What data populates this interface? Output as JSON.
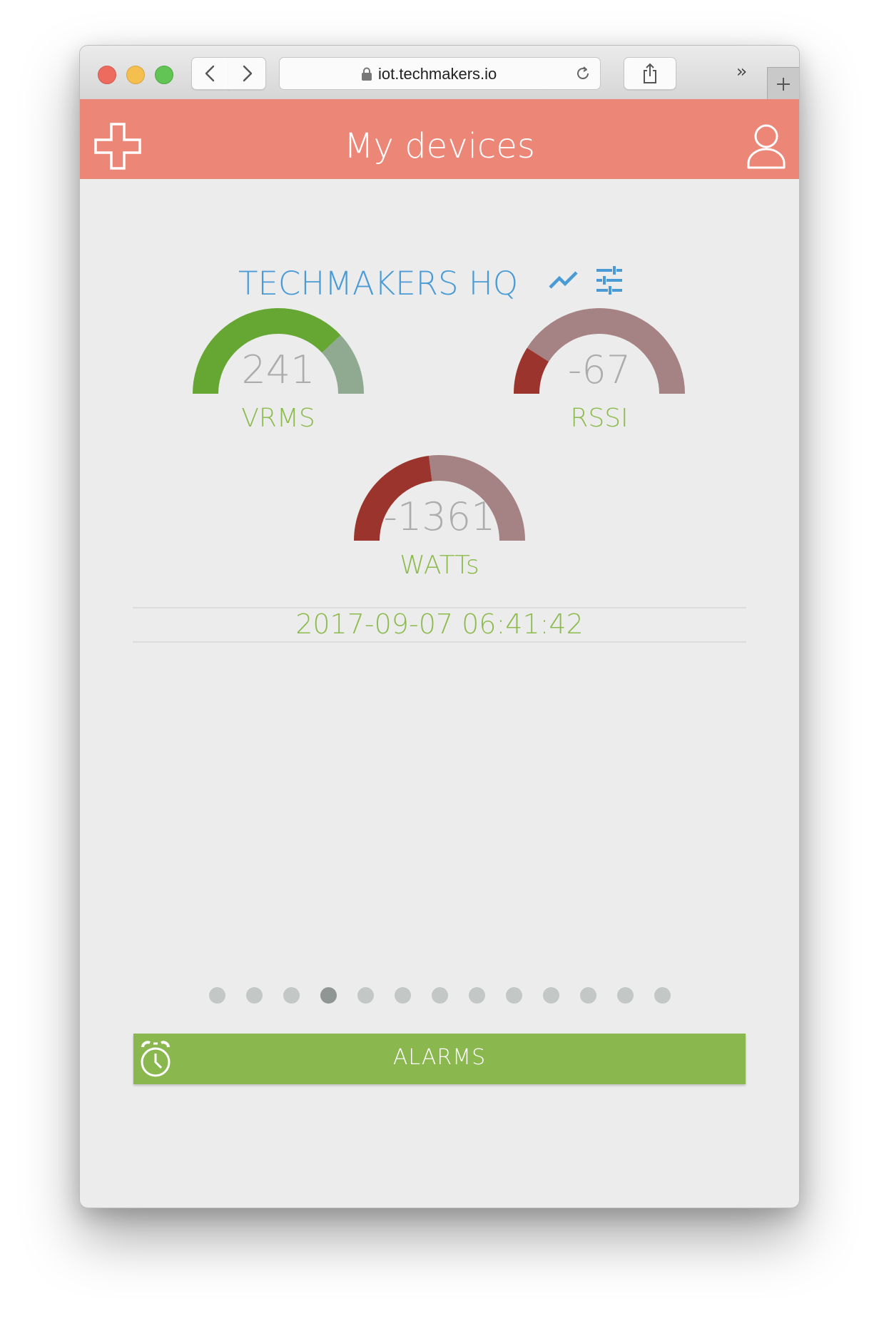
{
  "browser": {
    "url": "iot.techmakers.io",
    "icons": [
      "back-arrow-icon",
      "forward-arrow-icon",
      "lock-icon",
      "reload-icon",
      "share-icon",
      "chevrons-icon",
      "new-tab-icon"
    ]
  },
  "app": {
    "title": "My devices",
    "colors": {
      "header": "#ec8677",
      "accent_blue": "#4a9bd5",
      "accent_green": "#8ab84f"
    }
  },
  "device": {
    "name": "TECHMAKERS HQ",
    "gauges": [
      {
        "value": "241",
        "label": "VRMS",
        "level": 0.76,
        "fill_color": "#66a632",
        "track_color": "#8faa90"
      },
      {
        "value": "-67",
        "label": "RSSI",
        "level": 0.18,
        "fill_color": "#9b342c",
        "track_color": "#a58284"
      },
      {
        "value": "-1361",
        "label": "WATTs",
        "level": 0.46,
        "fill_color": "#9b342c",
        "track_color": "#a58284"
      }
    ],
    "timestamp": "2017-09-07 06:41:42"
  },
  "pagination": {
    "total": 13,
    "active_index": 3
  },
  "alarms": {
    "label": "ALARMS"
  }
}
